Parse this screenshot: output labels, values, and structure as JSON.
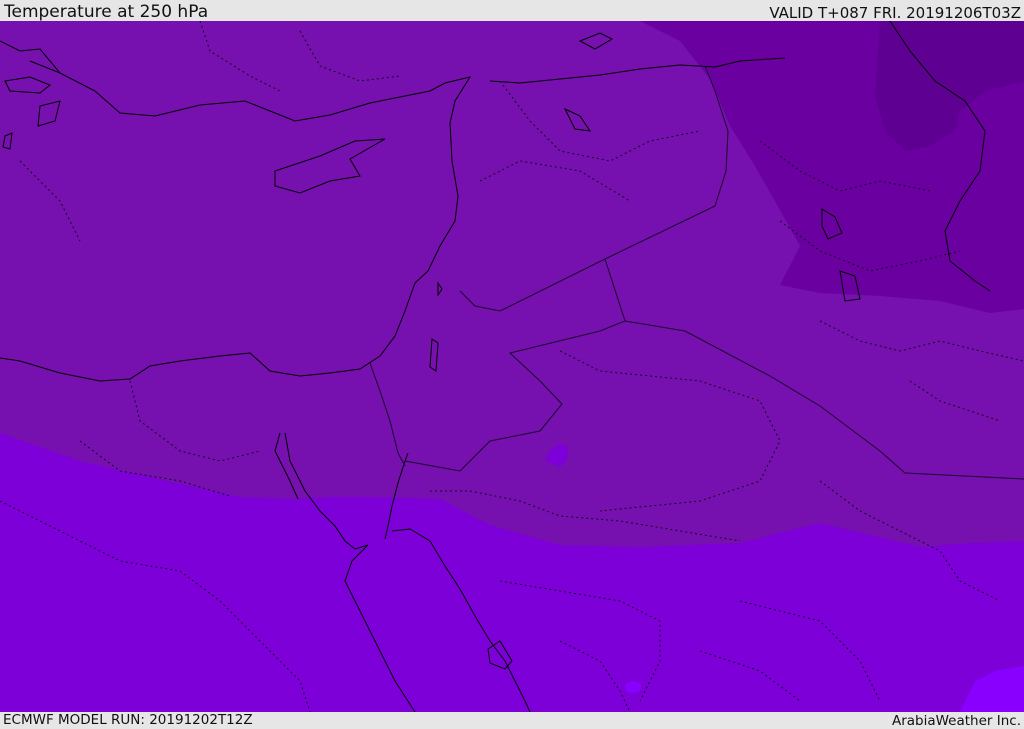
{
  "header": {
    "title": "Temperature at 250 hPa",
    "valid": "VALID T+087 FRI. 20191206T03Z"
  },
  "footer": {
    "model_run": "ECMWF MODEL RUN: 20191202T12Z",
    "credit": "ArabiaWeather Inc."
  },
  "map": {
    "fill_colors": {
      "band_coldest": "#5e0092",
      "band_cold": "#6a00a0",
      "band_mid": "#7610ae",
      "band_warm": "#7d00d8",
      "band_warmest": "#8a00ff"
    },
    "line_colors": {
      "coastline": "#000000",
      "border": "#1a0a2a"
    }
  }
}
